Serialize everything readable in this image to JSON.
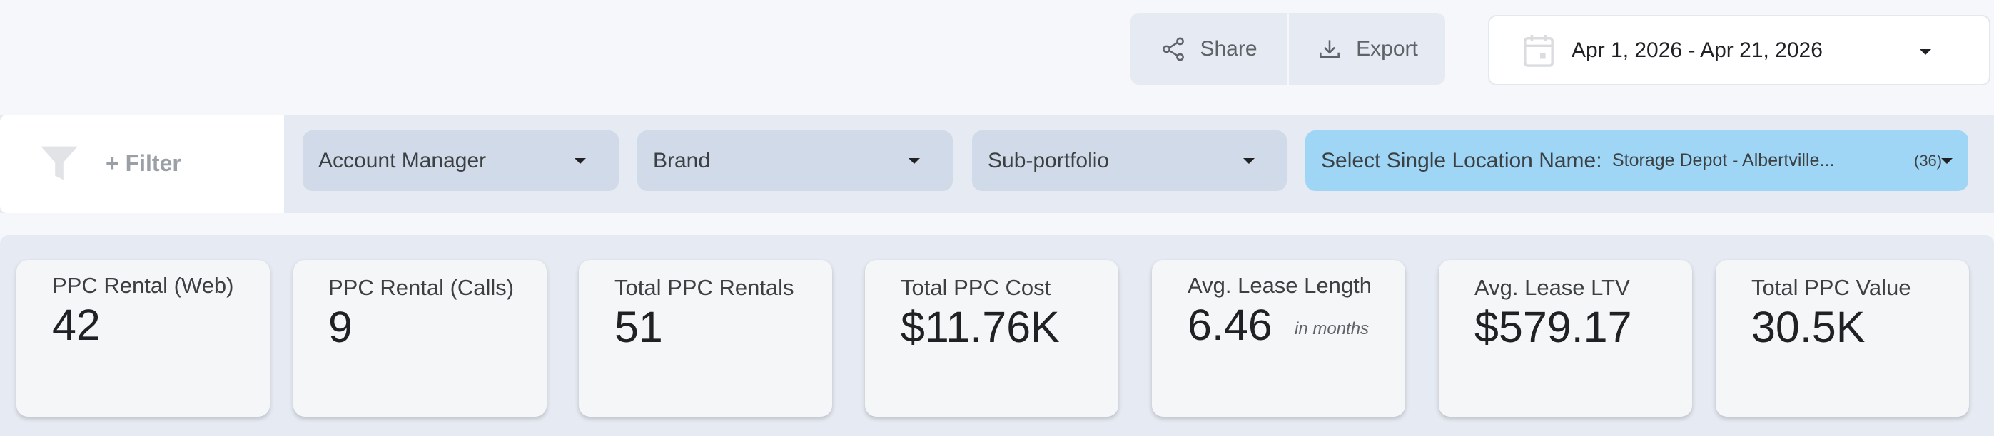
{
  "toolbar": {
    "share_label": "Share",
    "export_label": "Export",
    "share_icon": "share-icon",
    "export_icon": "download-icon"
  },
  "date_range": {
    "label": "Apr 1, 2026 - Apr 21, 2026",
    "icon": "calendar-icon"
  },
  "filters": {
    "add_filter_label": "+ Filter",
    "dropdowns": [
      {
        "label": "Account Manager"
      },
      {
        "label": "Brand"
      },
      {
        "label": "Sub-portfolio"
      },
      {
        "label": "Select Single Location Name:",
        "value": "Storage Depot - Albertville...",
        "count": "(36)"
      }
    ]
  },
  "kpis": [
    {
      "label": "PPC Rental (Web)",
      "value": "42"
    },
    {
      "label": "PPC Rental (Calls)",
      "value": "9"
    },
    {
      "label": "Total PPC Rentals",
      "value": "51"
    },
    {
      "label": "Total PPC Cost",
      "value": "$11.76K"
    },
    {
      "label": "Avg. Lease Length",
      "value": "6.46",
      "unit": "in months"
    },
    {
      "label": "Avg. Lease LTV",
      "value": "$579.17"
    },
    {
      "label": "Total PPC Value",
      "value": "30.5K"
    }
  ],
  "colors": {
    "page_bg": "#f5f7fa",
    "band_bg": "#e6eaf2",
    "dropdown_bg": "#d1dae8",
    "location_dropdown_bg": "#9fd6f6",
    "card_bg": "#f5f6f8"
  }
}
